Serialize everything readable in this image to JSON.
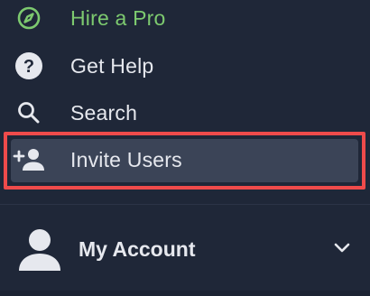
{
  "menu": {
    "items": [
      {
        "label": "Hire a Pro",
        "icon": "compass-icon",
        "color": "#7dca6f"
      },
      {
        "label": "Get Help",
        "icon": "help-circle-icon"
      },
      {
        "label": "Search",
        "icon": "search-icon"
      },
      {
        "label": "Invite Users",
        "icon": "add-user-icon",
        "highlighted": true
      }
    ]
  },
  "account": {
    "label": "My Account",
    "avatar_icon": "user-avatar-icon",
    "chevron_icon": "chevron-down-icon"
  },
  "colors": {
    "background": "#1f2738",
    "highlight_bg": "#3b4457",
    "highlight_border": "#ef4b4b",
    "accent_green": "#7dca6f",
    "text": "#e6e8ee"
  }
}
